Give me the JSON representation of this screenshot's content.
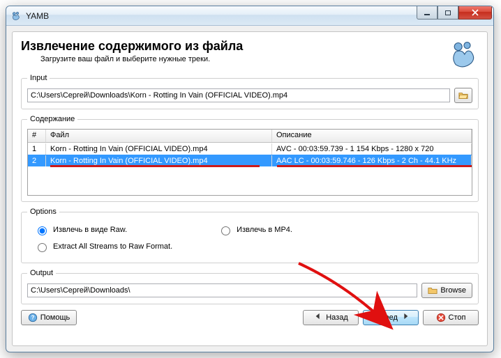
{
  "window": {
    "title": "YAMB"
  },
  "header": {
    "title": "Извлечение содержимого из файла",
    "subtitle": "Загрузите ваш файл и выберите нужные треки."
  },
  "input_group": {
    "label": "Input",
    "path": "C:\\Users\\Сергей\\Downloads\\Korn - Rotting In Vain (OFFICIAL VIDEO).mp4"
  },
  "content_group": {
    "label": "Содержание",
    "columns": {
      "num": "#",
      "file": "Файл",
      "desc": "Описание"
    },
    "rows": [
      {
        "num": "1",
        "file": "Korn - Rotting In Vain (OFFICIAL VIDEO).mp4",
        "desc": "AVC - 00:03:59.739 - 1 154 Kbps - 1280 x 720",
        "selected": false
      },
      {
        "num": "2",
        "file": "Korn - Rotting In Vain (OFFICIAL VIDEO).mp4",
        "desc": "AAC LC - 00:03:59.746 - 126 Kbps - 2 Ch - 44.1 KHz",
        "selected": true
      }
    ]
  },
  "options_group": {
    "label": "Options",
    "raw_label": "Извлечь в виде Raw.",
    "mp4_label": "Извлечь в MP4.",
    "extract_all_label": "Extract All Streams to Raw Format."
  },
  "output_group": {
    "label": "Output",
    "path": "C:\\Users\\Сергей\\Downloads\\",
    "browse_label": "Browse"
  },
  "buttons": {
    "help": "Помощь",
    "back": "Назад",
    "next": "Вперед",
    "stop": "Стоп"
  }
}
